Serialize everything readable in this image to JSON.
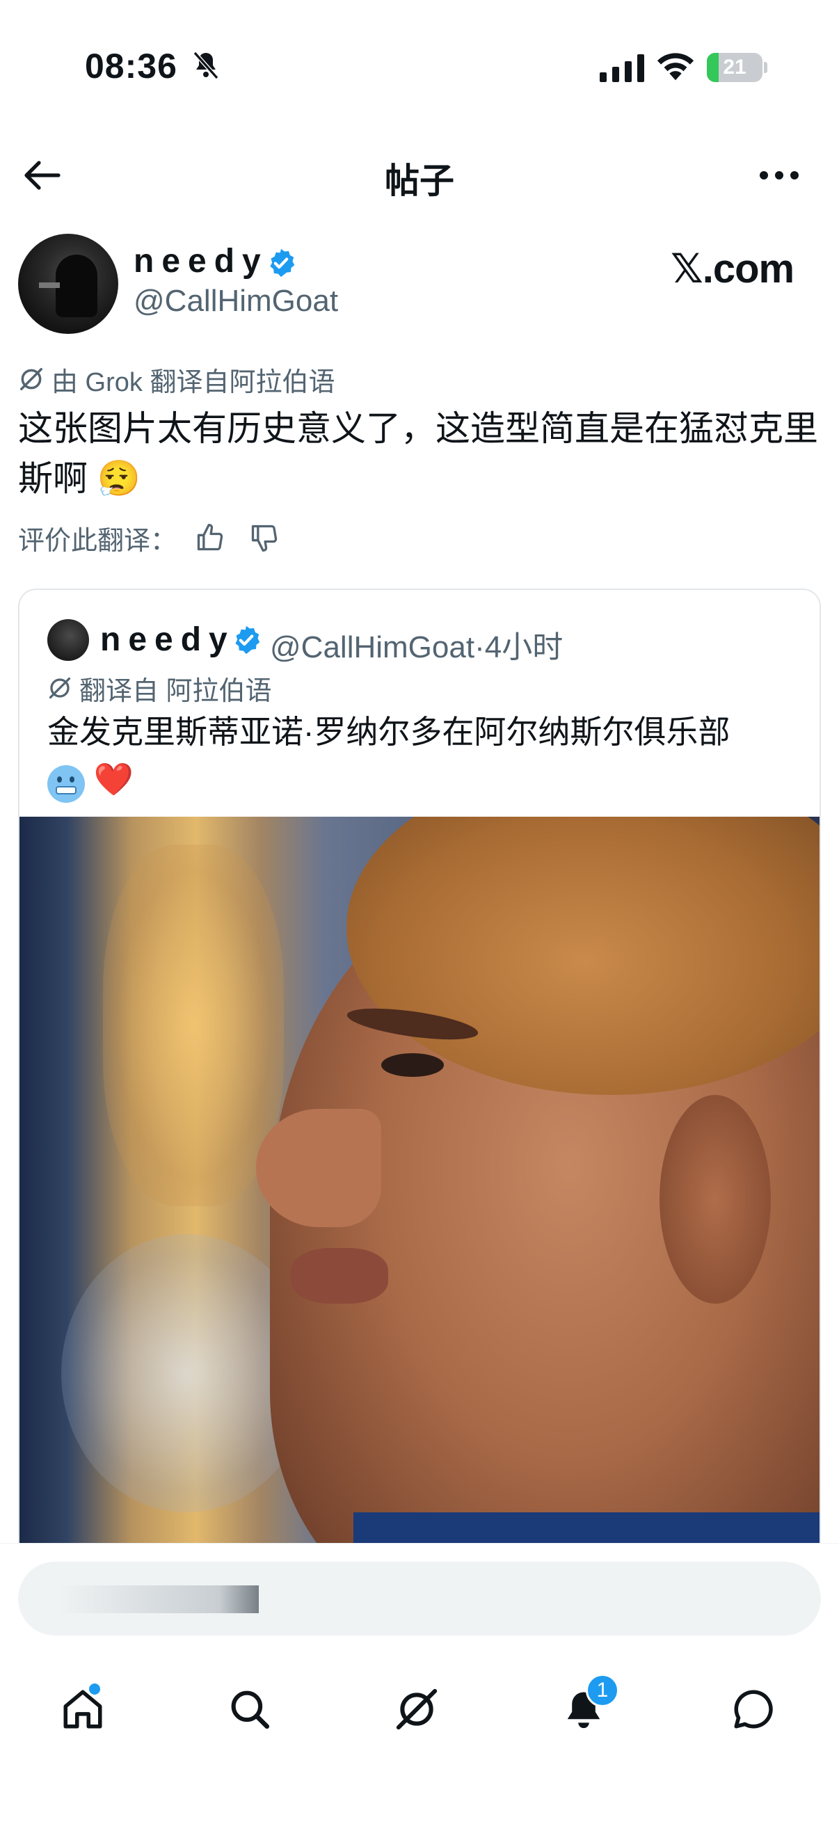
{
  "status_bar": {
    "time": "08:36",
    "battery": "21",
    "battery_level_percent": 21,
    "icons": [
      "bell-muted-icon",
      "cellular-signal-icon",
      "wifi-icon",
      "battery-icon"
    ]
  },
  "header": {
    "title": "帖子",
    "icons": [
      "back-arrow-icon",
      "more-icon"
    ]
  },
  "post": {
    "author_name": "needy",
    "author_handle": "@CallHimGoat",
    "source_watermark": "𝕏.com",
    "translation_note": "由 Grok 翻译自阿拉伯语",
    "text": "这张图片太有历史意义了，这造型简直是在猛怼克里斯啊 😮‍💨",
    "rate_translation_label": "评价此翻译："
  },
  "quoted_post": {
    "author_name": "needy",
    "author_handle": "@CallHimGoat",
    "separator": "·",
    "time": "4小时",
    "translation_note": "翻译自 阿拉伯语",
    "text": "金发克里斯蒂亚诺·罗纳尔多在阿尔纳斯尔俱乐部",
    "emoji_cold": "cold-face-icon",
    "emoji_heart": "❤️"
  },
  "bottom_nav": {
    "items": [
      "home-icon",
      "search-icon",
      "grok-icon",
      "notifications-icon",
      "messages-icon"
    ],
    "notification_count": "1"
  },
  "colors": {
    "accent": "#1d9bf0",
    "secondary_text": "#536471",
    "primary_text": "#0f1419",
    "battery_green": "#34c759"
  }
}
